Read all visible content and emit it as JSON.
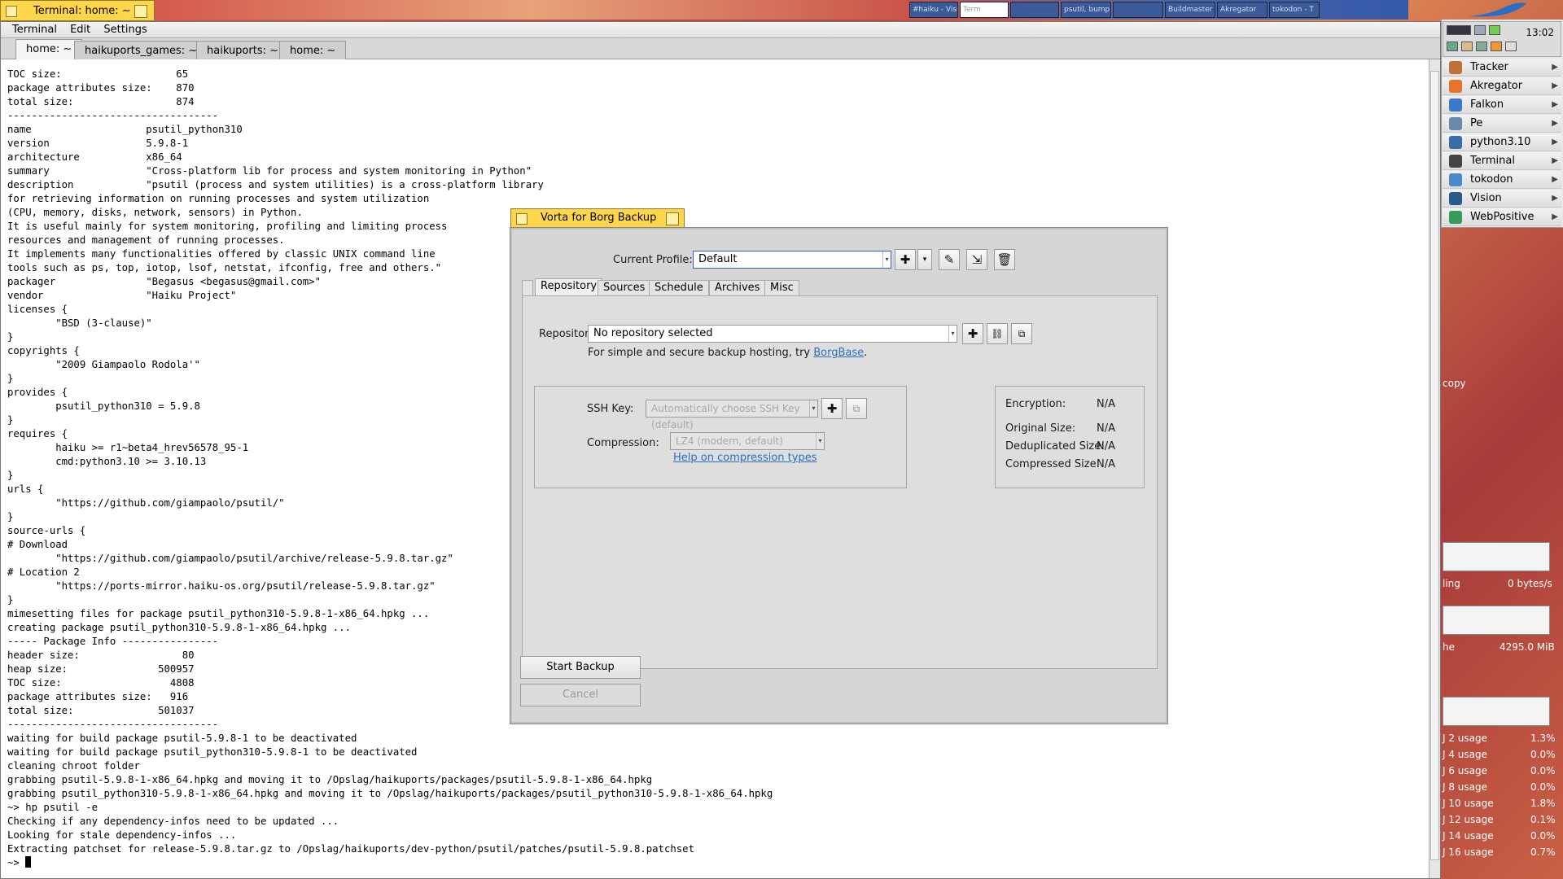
{
  "terminal": {
    "window_title": "Terminal: home: ~",
    "menu": [
      "Terminal",
      "Edit",
      "Settings"
    ],
    "tabs": [
      "home: ~",
      "haikuports_games: ~",
      "haikuports: ~",
      "home: ~"
    ],
    "lines": [
      "TOC size:                   65",
      "package attributes size:    870",
      "total size:                 874",
      "-----------------------------------",
      "name                   psutil_python310",
      "version                5.9.8-1",
      "architecture           x86_64",
      "summary                \"Cross-platform lib for process and system monitoring in Python\"",
      "description            \"psutil (process and system utilities) is a cross-platform library",
      "for retrieving information on running processes and system utilization",
      "(CPU, memory, disks, network, sensors) in Python.",
      "It is useful mainly for system monitoring, profiling and limiting process",
      "resources and management of running processes.",
      "It implements many functionalities offered by classic UNIX command line",
      "tools such as ps, top, iotop, lsof, netstat, ifconfig, free and others.\"",
      "packager               \"Begasus <begasus@gmail.com>\"",
      "vendor                 \"Haiku Project\"",
      "licenses {",
      "        \"BSD (3-clause)\"",
      "}",
      "copyrights {",
      "        \"2009 Giampaolo Rodola'\"",
      "}",
      "provides {",
      "        psutil_python310 = 5.9.8",
      "}",
      "requires {",
      "        haiku >= r1~beta4_hrev56578_95-1",
      "        cmd:python3.10 >= 3.10.13",
      "}",
      "urls {",
      "        \"https://github.com/giampaolo/psutil/\"",
      "}",
      "source-urls {",
      "# Download",
      "        \"https://github.com/giampaolo/psutil/archive/release-5.9.8.tar.gz\"",
      "# Location 2",
      "        \"https://ports-mirror.haiku-os.org/psutil/release-5.9.8.tar.gz\"",
      "}",
      "mimesetting files for package psutil_python310-5.9.8-1-x86_64.hpkg ...",
      "creating package psutil_python310-5.9.8-1-x86_64.hpkg ...",
      "----- Package Info ----------------",
      "header size:                 80",
      "heap size:               500957",
      "TOC size:                  4808",
      "package attributes size:   916",
      "total size:              501037",
      "-----------------------------------",
      "waiting for build package psutil-5.9.8-1 to be deactivated",
      "waiting for build package psutil_python310-5.9.8-1 to be deactivated",
      "cleaning chroot folder",
      "grabbing psutil-5.9.8-1-x86_64.hpkg and moving it to /Opslag/haikuports/packages/psutil-5.9.8-1-x86_64.hpkg",
      "grabbing psutil_python310-5.9.8-1-x86_64.hpkg and moving it to /Opslag/haikuports/packages/psutil_python310-5.9.8-1-x86_64.hpkg",
      "~> hp psutil -e",
      "Checking if any dependency-infos need to be updated ...",
      "Looking for stale dependency-infos ...",
      "Extracting patchset for release-5.9.8.tar.gz to /Opslag/haikuports/dev-python/psutil/patches/psutil-5.9.8.patchset"
    ],
    "prompt": "~> "
  },
  "taskbar_thumbs": [
    "#haiku - Visi",
    "Term",
    "",
    "psutil, bump",
    "",
    "Buildmaster",
    "Akregator",
    "tokodon - T"
  ],
  "deskbar": {
    "clock": "13:02",
    "items": [
      {
        "label": "Tracker",
        "icon": "tracker-icon",
        "color": "#c0703a"
      },
      {
        "label": "Akregator",
        "icon": "rss-icon",
        "color": "#e8742a"
      },
      {
        "label": "Falkon",
        "icon": "falkon-icon",
        "color": "#3a78c8"
      },
      {
        "label": "Pe",
        "icon": "pe-icon",
        "color": "#6a8aa8"
      },
      {
        "label": "python3.10",
        "icon": "python-icon",
        "color": "#3a6ea8"
      },
      {
        "label": "Terminal",
        "icon": "terminal-icon",
        "color": "#444444"
      },
      {
        "label": "tokodon",
        "icon": "tokodon-icon",
        "color": "#4a8ac8"
      },
      {
        "label": "Vision",
        "icon": "vision-icon",
        "color": "#2a5a8a"
      },
      {
        "label": "WebPositive",
        "icon": "globe-icon",
        "color": "#3a9a5a"
      }
    ]
  },
  "side": {
    "copy": "copy",
    "ling": "ling",
    "bytes": "0 bytes/s",
    "he": "he",
    "mib": "4295.0 MiB",
    "usage": [
      {
        "label": "J 2 usage",
        "value": "1.3%"
      },
      {
        "label": "J 4 usage",
        "value": "0.0%"
      },
      {
        "label": "J 6 usage",
        "value": "0.0%"
      },
      {
        "label": "J 8 usage",
        "value": "0.0%"
      },
      {
        "label": "J 10 usage",
        "value": "1.8%"
      },
      {
        "label": "J 12 usage",
        "value": "0.1%"
      },
      {
        "label": "J 14 usage",
        "value": "0.0%"
      },
      {
        "label": "J 16 usage",
        "value": "0.7%"
      }
    ]
  },
  "vorta": {
    "title": "Vorta for Borg Backup",
    "profile_label": "Current Profile:",
    "profile_value": "Default",
    "tabs": [
      "Repository",
      "Sources",
      "Schedule",
      "Archives",
      "Misc"
    ],
    "repo_label": "Repository:",
    "repo_value": "No repository selected",
    "hint_text": "For simple and secure backup hosting, try ",
    "hint_link": "BorgBase",
    "hint_end": ".",
    "ssh_label": "SSH Key:",
    "ssh_value": "Automatically choose SSH Key (default)",
    "compression_label": "Compression:",
    "compression_value": "LZ4 (modern, default)",
    "compression_help": "Help on compression types",
    "stats": [
      {
        "label": "Encryption:",
        "value": "N/A"
      },
      {
        "label": "Original Size:",
        "value": "N/A"
      },
      {
        "label": "Deduplicated Size:",
        "value": "N/A"
      },
      {
        "label": "Compressed Size:",
        "value": "N/A"
      }
    ],
    "start_backup": "Start Backup",
    "cancel": "Cancel"
  }
}
